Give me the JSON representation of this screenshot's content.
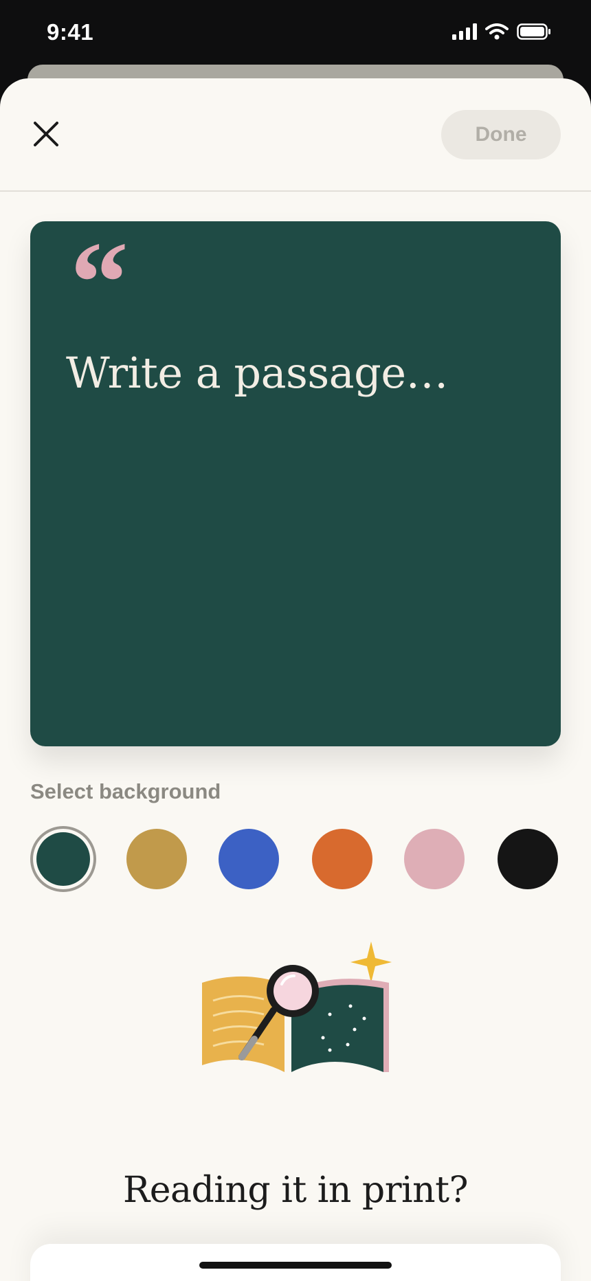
{
  "status_bar": {
    "time": "9:41",
    "icons": [
      "signal-icon",
      "wifi-icon",
      "battery-icon"
    ]
  },
  "header": {
    "close_icon": "close-icon",
    "done_label": "Done"
  },
  "quote_card": {
    "quote_mark": "“",
    "placeholder": "Write a passage…",
    "background_color": "#1f4b45",
    "quote_mark_color": "#e0a9b4"
  },
  "background_picker": {
    "label": "Select background",
    "selected_index": 0,
    "colors": [
      "#1f4b45",
      "#c19a4b",
      "#3c61c4",
      "#d86a2e",
      "#deaeb6",
      "#151515"
    ]
  },
  "print_section": {
    "illustration": "book-magnifier-illustration",
    "heading": "Reading it in print?"
  }
}
